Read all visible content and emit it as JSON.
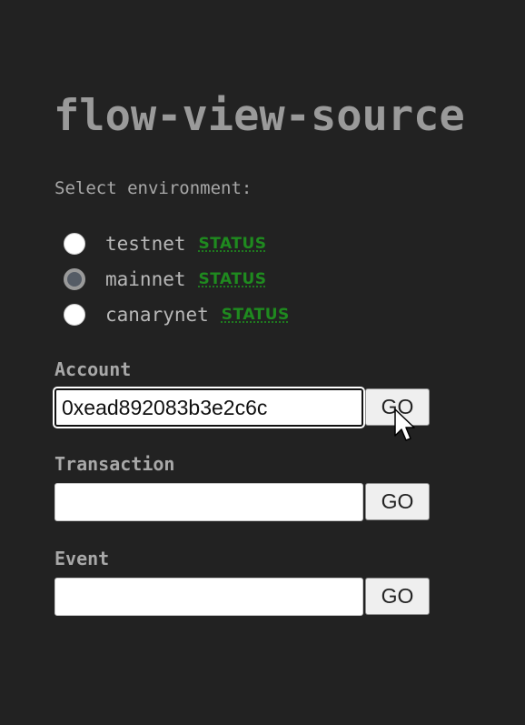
{
  "header": {
    "title": "flow-view-source"
  },
  "environment": {
    "prompt": "Select environment:",
    "options": [
      {
        "label": "testnet",
        "status_label": "STATUS",
        "selected": false
      },
      {
        "label": "mainnet",
        "status_label": "STATUS",
        "selected": true
      },
      {
        "label": "canarynet",
        "status_label": "STATUS",
        "selected": false
      }
    ]
  },
  "account": {
    "label": "Account",
    "value": "0xead892083b3e2c6c",
    "button_label": "GO"
  },
  "transaction": {
    "label": "Transaction",
    "value": "",
    "button_label": "GO"
  },
  "event": {
    "label": "Event",
    "value": "",
    "button_label": "GO"
  },
  "colors": {
    "background": "#222222",
    "status_link": "#1f8a1f",
    "text": "#b0b0b0"
  },
  "icons": {
    "pointer": "mouse-pointer-icon"
  }
}
